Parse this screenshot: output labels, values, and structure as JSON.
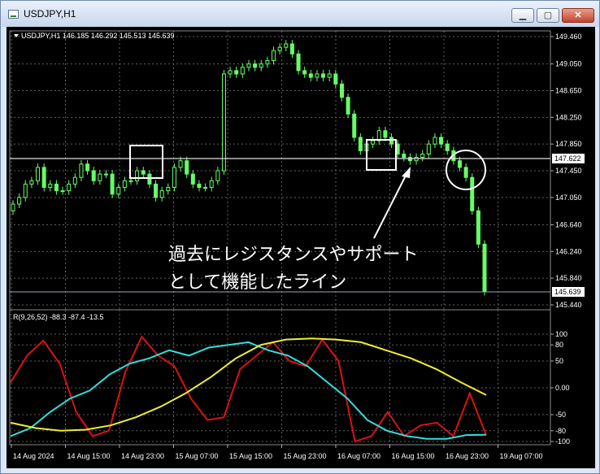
{
  "window": {
    "title": "USDJPY,H1",
    "min_label": "▁",
    "max_label": "▢",
    "close_label": "✕"
  },
  "main_panel": {
    "symbol_info": "USDJPY,H1  146.185 146.292 145.513 145.639",
    "price_labels": [
      "149.460",
      "149.050",
      "148.650",
      "148.250",
      "147.850",
      "147.450",
      "147.050",
      "146.640",
      "146.240",
      "145.840",
      "145.440"
    ],
    "hline_price_label": "147.622",
    "last_price_label": "145.639",
    "annotation_line1": "過去にレジスタンスやサポート",
    "annotation_line2": "として機能したライン"
  },
  "indicator_panel": {
    "info": "R(9,26,52) -88.3 -87.4 -13.5",
    "scale_labels": [
      "100",
      "80",
      "50",
      "0.00",
      "-50",
      "-80",
      "-100"
    ]
  },
  "time_labels": [
    "14 Aug 2024",
    "14 Aug 15:00",
    "14 Aug 23:00",
    "15 Aug 07:00",
    "15 Aug 15:00",
    "15 Aug 23:00",
    "16 Aug 07:00",
    "16 Aug 15:00",
    "16 Aug 23:00",
    "19 Aug 07:00"
  ],
  "colors": {
    "background": "#000000",
    "candle": "#66ff66",
    "grid": "#606060",
    "line_red": "#dd1111",
    "line_cyan": "#33dddd",
    "line_yellow": "#eeee33"
  },
  "chart_data": [
    {
      "type": "candlestick",
      "title": "USDJPY,H1",
      "ylim": [
        145.44,
        149.46
      ],
      "x": [
        "14 Aug 2024",
        "14 Aug 15:00",
        "14 Aug 23:00",
        "15 Aug 07:00",
        "15 Aug 15:00",
        "15 Aug 23:00",
        "16 Aug 07:00",
        "16 Aug 15:00",
        "16 Aug 23:00",
        "19 Aug 07:00"
      ],
      "close_series": [
        146.95,
        147.05,
        147.25,
        147.3,
        147.5,
        147.2,
        147.25,
        147.15,
        147.15,
        147.25,
        147.35,
        147.55,
        147.45,
        147.3,
        147.4,
        147.4,
        147.1,
        147.2,
        147.3,
        147.3,
        147.45,
        147.4,
        147.25,
        147.05,
        147.15,
        147.2,
        147.5,
        147.6,
        147.4,
        147.25,
        147.2,
        147.2,
        147.3,
        147.45,
        148.9,
        148.95,
        148.9,
        149.0,
        149.05,
        149.0,
        149.05,
        149.1,
        149.25,
        149.3,
        149.35,
        149.2,
        148.95,
        148.9,
        148.85,
        148.9,
        148.85,
        148.9,
        148.75,
        148.55,
        148.3,
        147.95,
        147.75,
        147.85,
        147.9,
        148.05,
        147.95,
        147.85,
        147.7,
        147.65,
        147.6,
        147.65,
        147.7,
        147.85,
        147.95,
        147.85,
        147.75,
        147.6,
        147.5,
        147.35,
        146.85,
        146.35,
        145.64
      ],
      "reference_lines": [
        147.622,
        145.639
      ]
    },
    {
      "type": "line",
      "title": "R(9,26,52)",
      "ylim": [
        -100,
        100
      ],
      "x": [
        "14 Aug 2024",
        "14 Aug 15:00",
        "14 Aug 23:00",
        "15 Aug 07:00",
        "15 Aug 15:00",
        "15 Aug 23:00",
        "16 Aug 07:00",
        "16 Aug 15:00",
        "16 Aug 23:00",
        "19 Aug 07:00"
      ],
      "series": [
        {
          "values": [
            10,
            60,
            88,
            45,
            -45,
            -90,
            -80,
            30,
            95,
            60,
            40,
            -20,
            -60,
            -55,
            35,
            60,
            85,
            50,
            40,
            90,
            50,
            -100,
            -90,
            -45,
            -90,
            -70,
            -65,
            -90,
            -10,
            -88.3
          ]
        },
        {
          "values": [
            -90,
            -75,
            -45,
            -20,
            -5,
            25,
            45,
            55,
            70,
            60,
            75,
            80,
            85,
            70,
            60,
            40,
            10,
            -20,
            -60,
            -80,
            -90,
            -95,
            -95,
            -88,
            -87.4
          ]
        },
        {
          "values": [
            -65,
            -75,
            -80,
            -78,
            -70,
            -55,
            -35,
            -10,
            20,
            55,
            80,
            90,
            92,
            90,
            85,
            70,
            55,
            35,
            10,
            -13.5
          ]
        }
      ]
    }
  ]
}
